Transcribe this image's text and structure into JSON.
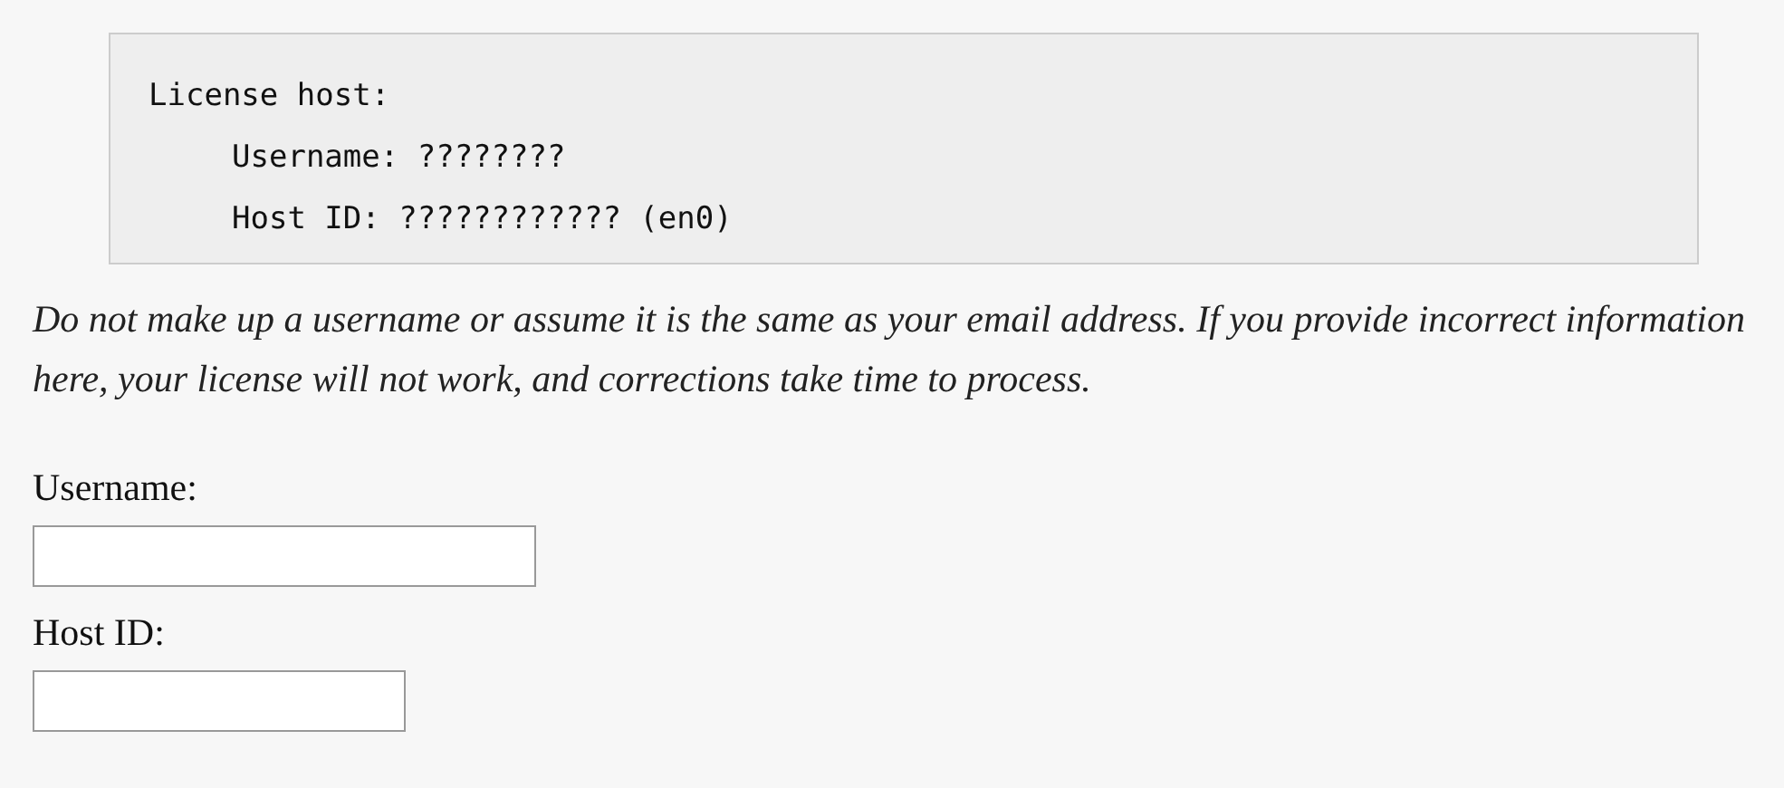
{
  "code_block": {
    "lines": [
      {
        "text": "License host:",
        "children": [
          {
            "text": "Username: ????????"
          },
          {
            "text": "Host ID: ???????????? (en0)"
          }
        ]
      }
    ]
  },
  "notice": "Do not make up a username or assume it is the same as your email address. If you provide incorrect information here, your license will not work, and corrections take time to process.",
  "form": {
    "fields": [
      {
        "label": "Username:",
        "kind": "wide"
      },
      {
        "label": "Host ID:",
        "kind": "narrow"
      }
    ]
  }
}
